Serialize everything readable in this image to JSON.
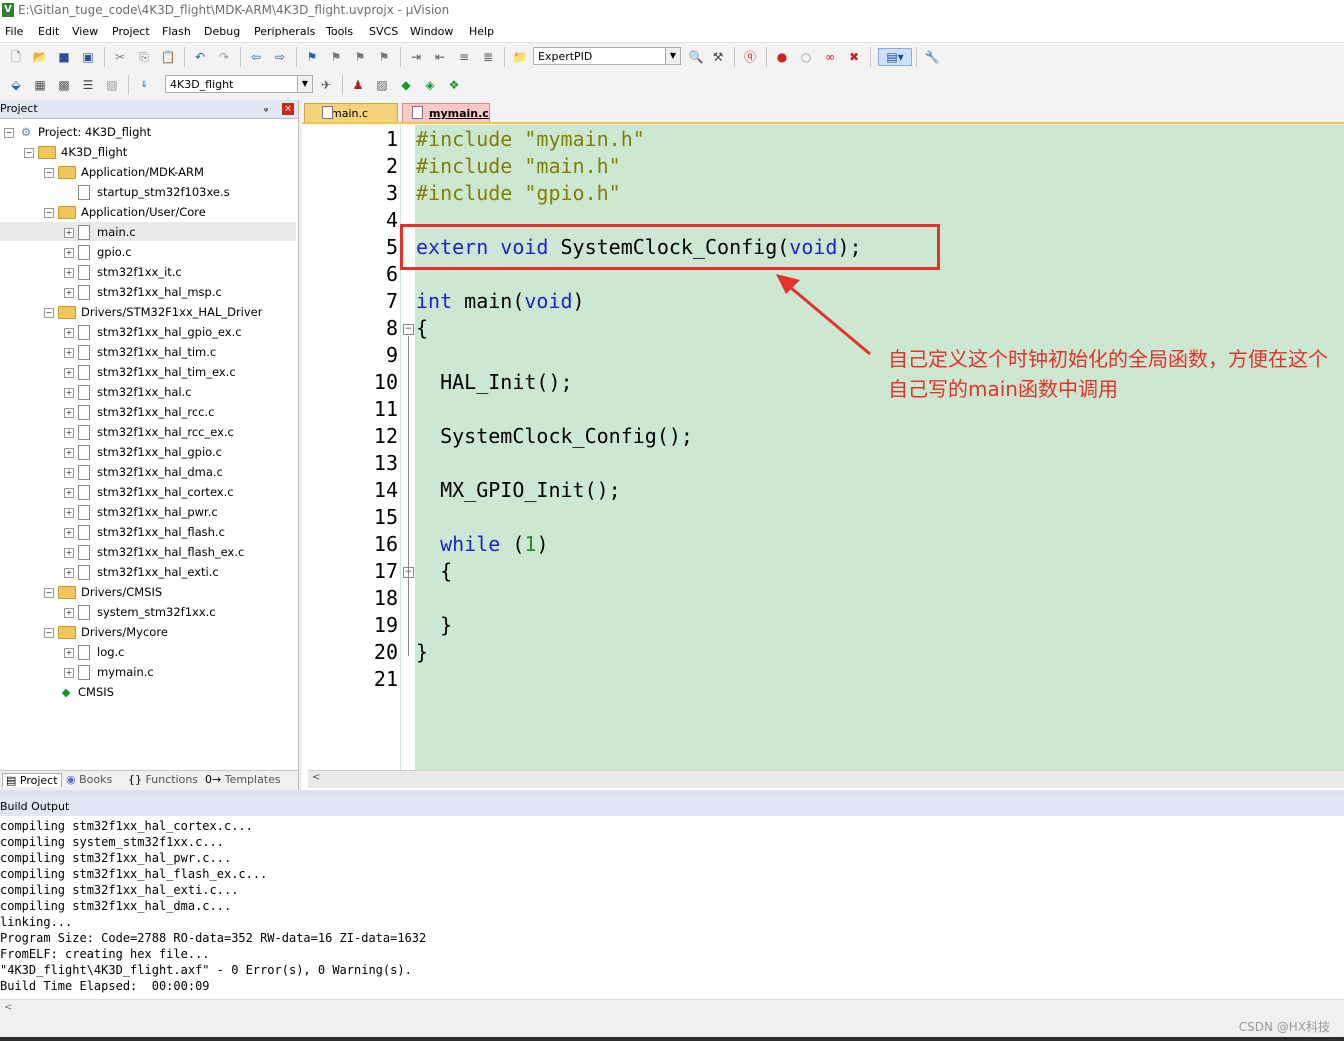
{
  "window": {
    "title": "E:\\Gitlan_tuge_code\\4K3D_flight\\MDK-ARM\\4K3D_flight.uvprojx - µVision",
    "app_icon_letter": "V"
  },
  "menu": [
    "File",
    "Edit",
    "View",
    "Project",
    "Flash",
    "Debug",
    "Peripherals",
    "Tools",
    "SVCS",
    "Window",
    "Help"
  ],
  "toolbar": {
    "find_combo_value": "ExpertPID",
    "target_combo_value": "4K3D_flight"
  },
  "project_panel": {
    "title": "Project",
    "pin": "ᵩ",
    "close": "×",
    "tree": [
      {
        "label": "Project: 4K3D_flight",
        "level": 0,
        "type": "project",
        "expander": "−"
      },
      {
        "label": "4K3D_flight",
        "level": 1,
        "type": "target",
        "expander": "−"
      },
      {
        "label": "Application/MDK-ARM",
        "level": 2,
        "type": "folder",
        "expander": "−"
      },
      {
        "label": "startup_stm32f103xe.s",
        "level": 3,
        "type": "file",
        "expander": ""
      },
      {
        "label": "Application/User/Core",
        "level": 2,
        "type": "folder",
        "expander": "−"
      },
      {
        "label": "main.c",
        "level": 3,
        "type": "file",
        "expander": "+"
      },
      {
        "label": "gpio.c",
        "level": 3,
        "type": "file",
        "expander": "+"
      },
      {
        "label": "stm32f1xx_it.c",
        "level": 3,
        "type": "file",
        "expander": "+"
      },
      {
        "label": "stm32f1xx_hal_msp.c",
        "level": 3,
        "type": "file",
        "expander": "+"
      },
      {
        "label": "Drivers/STM32F1xx_HAL_Driver",
        "level": 2,
        "type": "folder",
        "expander": "−"
      },
      {
        "label": "stm32f1xx_hal_gpio_ex.c",
        "level": 3,
        "type": "file",
        "expander": "+"
      },
      {
        "label": "stm32f1xx_hal_tim.c",
        "level": 3,
        "type": "file",
        "expander": "+"
      },
      {
        "label": "stm32f1xx_hal_tim_ex.c",
        "level": 3,
        "type": "file",
        "expander": "+"
      },
      {
        "label": "stm32f1xx_hal.c",
        "level": 3,
        "type": "file",
        "expander": "+"
      },
      {
        "label": "stm32f1xx_hal_rcc.c",
        "level": 3,
        "type": "file",
        "expander": "+"
      },
      {
        "label": "stm32f1xx_hal_rcc_ex.c",
        "level": 3,
        "type": "file",
        "expander": "+"
      },
      {
        "label": "stm32f1xx_hal_gpio.c",
        "level": 3,
        "type": "file",
        "expander": "+"
      },
      {
        "label": "stm32f1xx_hal_dma.c",
        "level": 3,
        "type": "file",
        "expander": "+"
      },
      {
        "label": "stm32f1xx_hal_cortex.c",
        "level": 3,
        "type": "file",
        "expander": "+"
      },
      {
        "label": "stm32f1xx_hal_pwr.c",
        "level": 3,
        "type": "file",
        "expander": "+"
      },
      {
        "label": "stm32f1xx_hal_flash.c",
        "level": 3,
        "type": "file",
        "expander": "+"
      },
      {
        "label": "stm32f1xx_hal_flash_ex.c",
        "level": 3,
        "type": "file",
        "expander": "+"
      },
      {
        "label": "stm32f1xx_hal_exti.c",
        "level": 3,
        "type": "file",
        "expander": "+"
      },
      {
        "label": "Drivers/CMSIS",
        "level": 2,
        "type": "folder",
        "expander": "−"
      },
      {
        "label": "system_stm32f1xx.c",
        "level": 3,
        "type": "file",
        "expander": "+"
      },
      {
        "label": "Drivers/Mycore",
        "level": 2,
        "type": "folder",
        "expander": "−"
      },
      {
        "label": "log.c",
        "level": 3,
        "type": "file",
        "expander": "+"
      },
      {
        "label": "mymain.c",
        "level": 3,
        "type": "file",
        "expander": "+"
      },
      {
        "label": "CMSIS",
        "level": 2,
        "type": "component",
        "expander": ""
      }
    ],
    "bottom_tabs": [
      "Project",
      "Books",
      "Functions",
      "Templates"
    ],
    "tab_icons": [
      "▤",
      "◉",
      "{}",
      "0→"
    ]
  },
  "editor": {
    "tabs": [
      {
        "label": "main.c",
        "active": false
      },
      {
        "label": "mymain.c",
        "active": true
      }
    ],
    "lines": [
      [
        {
          "t": "#include ",
          "c": "pp"
        },
        {
          "t": "\"mymain.h\"",
          "c": "pp"
        }
      ],
      [
        {
          "t": "#include ",
          "c": "pp"
        },
        {
          "t": "\"main.h\"",
          "c": "pp"
        }
      ],
      [
        {
          "t": "#include ",
          "c": "pp"
        },
        {
          "t": "\"gpio.h\"",
          "c": "pp"
        }
      ],
      [],
      [
        {
          "t": "extern",
          "c": "kw"
        },
        {
          "t": " "
        },
        {
          "t": "void",
          "c": "kw"
        },
        {
          "t": " SystemClock_Config("
        },
        {
          "t": "void",
          "c": "kw"
        },
        {
          "t": ");"
        }
      ],
      [],
      [
        {
          "t": "int",
          "c": "kw"
        },
        {
          "t": " main("
        },
        {
          "t": "void",
          "c": "kw"
        },
        {
          "t": ")"
        }
      ],
      [
        {
          "t": "{"
        }
      ],
      [],
      [
        {
          "t": "  HAL_Init();"
        }
      ],
      [],
      [
        {
          "t": "  SystemClock_Config();"
        }
      ],
      [],
      [
        {
          "t": "  MX_GPIO_Init();"
        }
      ],
      [],
      [
        {
          "t": "  "
        },
        {
          "t": "while",
          "c": "kw"
        },
        {
          "t": " ("
        },
        {
          "t": "1",
          "c": "num"
        },
        {
          "t": ")"
        }
      ],
      [
        {
          "t": "  {"
        }
      ],
      [],
      [
        {
          "t": "  }"
        }
      ],
      [
        {
          "t": "}"
        }
      ],
      []
    ],
    "fold_markers": [
      {
        "line": 8,
        "sym": "⊟"
      },
      {
        "line": 17,
        "sym": "⊟"
      }
    ]
  },
  "annotation": {
    "text": "自己定义这个时钟初始化的全局函数，方便在这个自己写的main函数中调用",
    "color": "#e8302a"
  },
  "build_output": {
    "title": "Build Output",
    "lines": [
      "compiling stm32f1xx_hal_cortex.c...",
      "compiling system_stm32f1xx.c...",
      "compiling stm32f1xx_hal_pwr.c...",
      "compiling stm32f1xx_hal_flash_ex.c...",
      "compiling stm32f1xx_hal_exti.c...",
      "compiling stm32f1xx_hal_dma.c...",
      "linking...",
      "Program Size: Code=2788 RO-data=352 RW-data=16 ZI-data=1632",
      "FromELF: creating hex file...",
      "\"4K3D_flight\\4K3D_flight.axf\" - 0 Error(s), 0 Warning(s).",
      "Build Time Elapsed:  00:00:09"
    ]
  },
  "watermark": "CSDN @HX科技"
}
